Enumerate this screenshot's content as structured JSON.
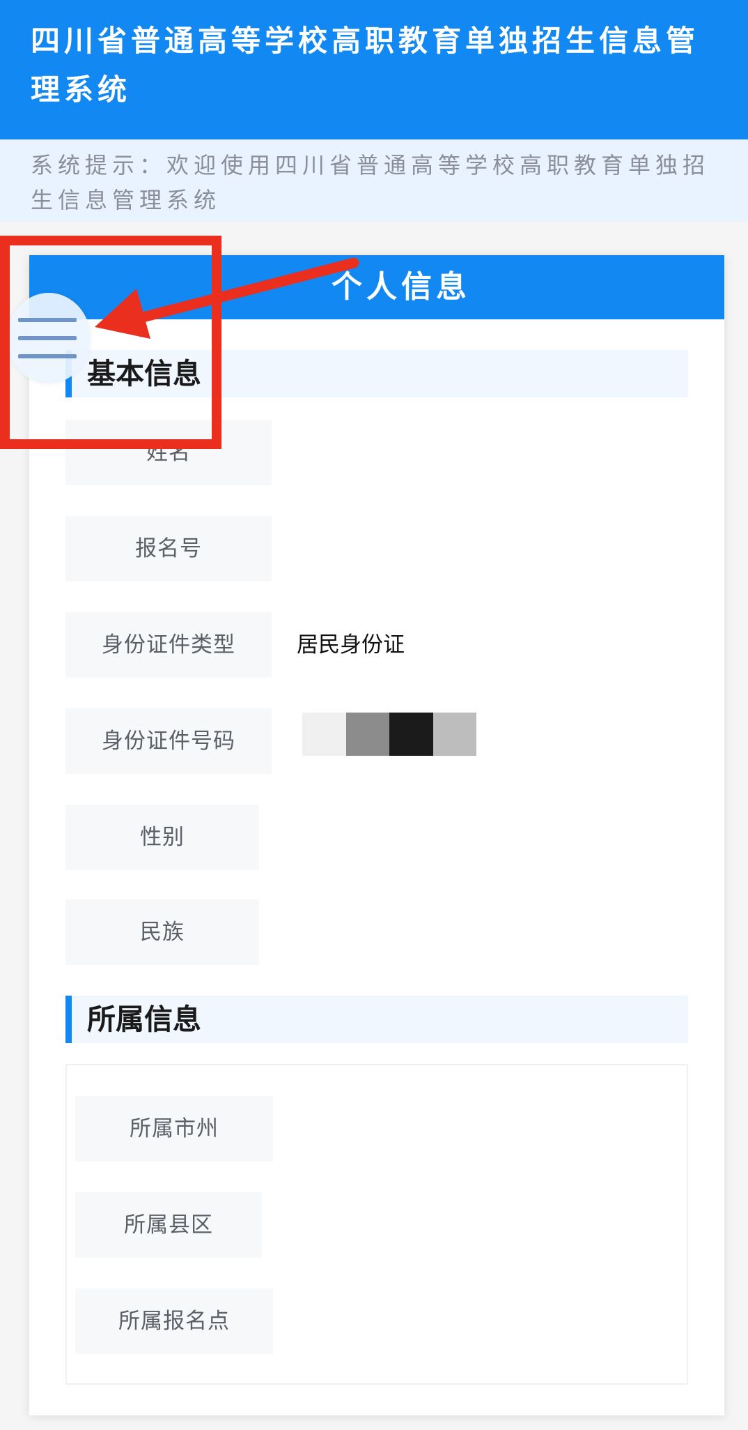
{
  "header": {
    "title": "四川省普通高等学校高职教育单独招生信息管理系统"
  },
  "notice": {
    "text": "系统提示：欢迎使用四川省普通高等学校高职教育单独招生信息管理系统"
  },
  "card": {
    "title": "个人信息"
  },
  "sections": {
    "basic": {
      "title": "基本信息",
      "fields": [
        {
          "label": "姓名",
          "value": ""
        },
        {
          "label": "报名号",
          "value": ""
        },
        {
          "label": "身份证件类型",
          "value": "居民身份证"
        },
        {
          "label": "身份证件号码",
          "value": ""
        },
        {
          "label": "性别",
          "value": ""
        },
        {
          "label": "民族",
          "value": ""
        }
      ]
    },
    "belong": {
      "title": "所属信息",
      "fields": [
        {
          "label": "所属市州",
          "value": ""
        },
        {
          "label": "所属县区",
          "value": ""
        },
        {
          "label": "所属报名点",
          "value": ""
        }
      ]
    }
  },
  "icons": {
    "menu": "hamburger-menu-icon",
    "arrow": "red-arrow-annotation"
  },
  "colors": {
    "primary": "#1188f2",
    "notice_bg": "#e8f3ff",
    "label_bg": "#f6f8fa",
    "annotation": "#ea2f1f"
  }
}
